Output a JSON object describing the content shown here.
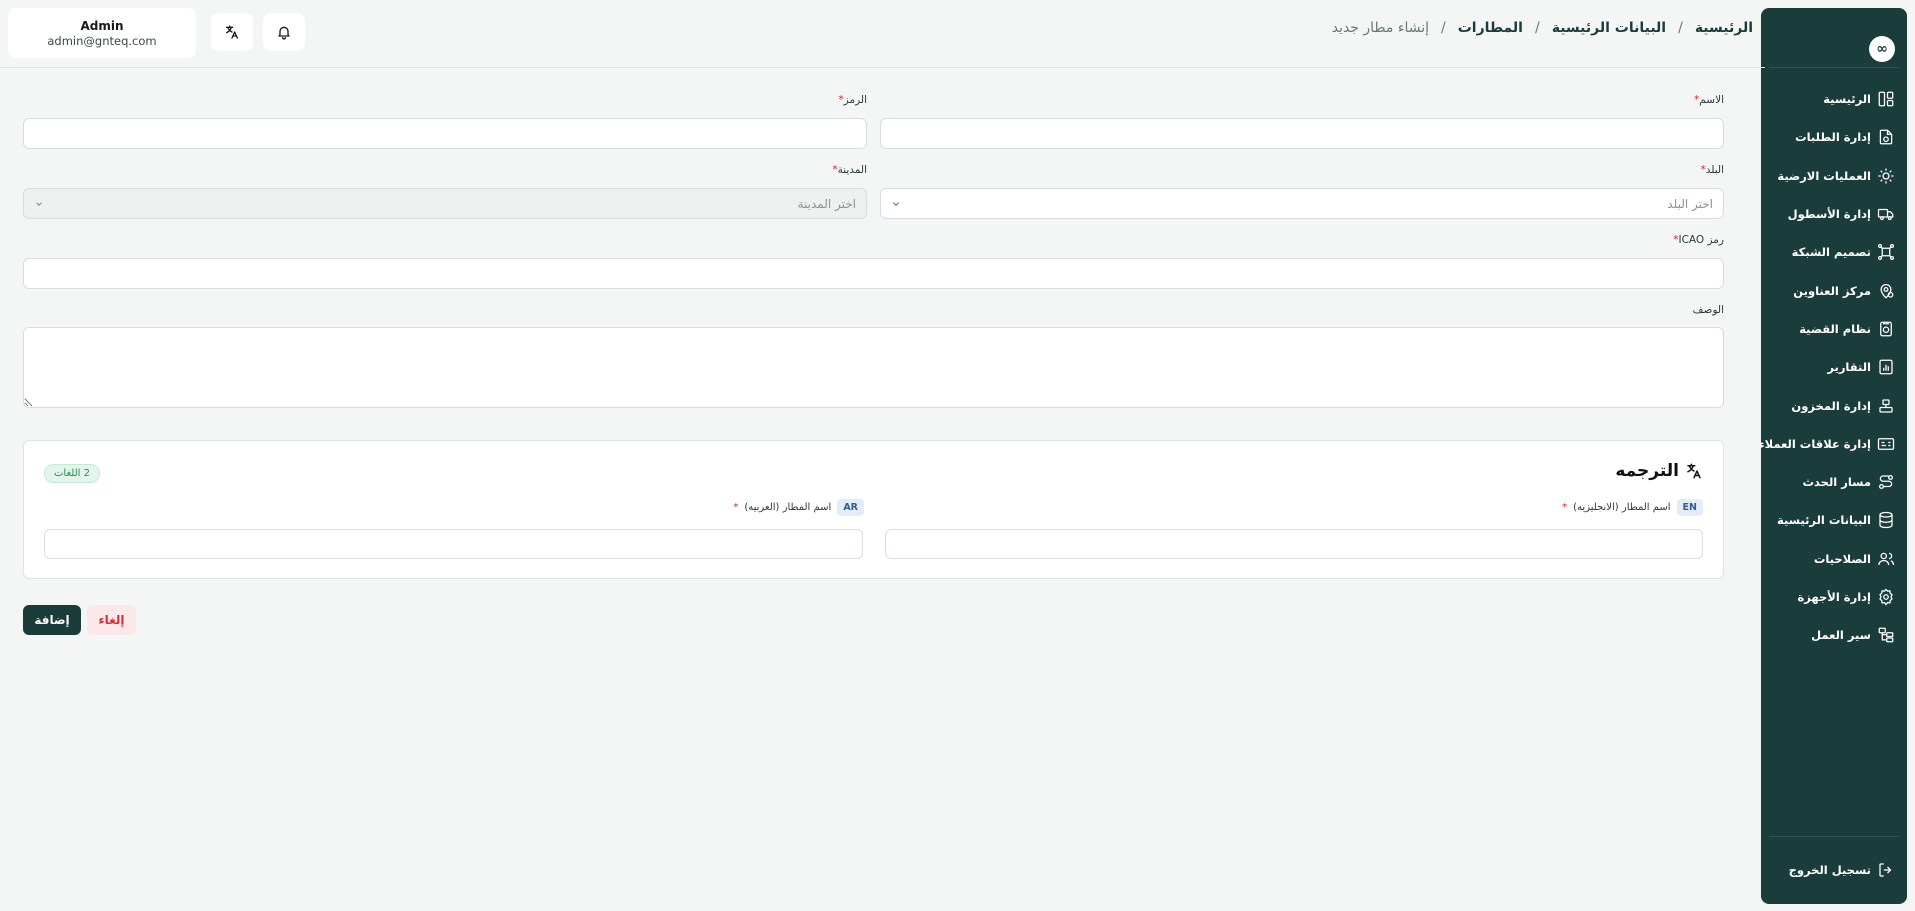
{
  "user": {
    "name": "Admin",
    "email": "admin@gnteq.com"
  },
  "header": {
    "translate_icon": "translate-icon",
    "bell_icon": "bell-icon"
  },
  "breadcrumb": {
    "items": [
      "الرئيسية",
      "البيانات الرئيسية",
      "المطارات"
    ],
    "current": "إنشاء مطار جديد",
    "separator": "/"
  },
  "sidebar": {
    "logo": "∞",
    "items": [
      {
        "label": "الرئيسية",
        "icon": "layout-dashboard-icon"
      },
      {
        "label": "إدارة الطلبات",
        "icon": "order-file-icon"
      },
      {
        "label": "العمليات الارضية",
        "icon": "ground-ops-gear-icon"
      },
      {
        "label": "إدارة الأسطول",
        "icon": "truck-icon"
      },
      {
        "label": "تصميم الشبكة",
        "icon": "network-icon"
      },
      {
        "label": "مركز العناوين",
        "icon": "map-pin-icon"
      },
      {
        "label": "نظام القضية",
        "icon": "case-file-icon"
      },
      {
        "label": "التقارير",
        "icon": "report-chart-icon"
      },
      {
        "label": "إدارة المخزون",
        "icon": "inventory-icon"
      },
      {
        "label": "إدارة علاقات العملاء",
        "icon": "crm-card-icon"
      },
      {
        "label": "مسار الحدث",
        "icon": "route-icon"
      },
      {
        "label": "البيانات الرئيسية",
        "icon": "database-icon"
      },
      {
        "label": "الصلاحيات",
        "icon": "users-icon"
      },
      {
        "label": "إدارة الأجهزة",
        "icon": "device-settings-icon"
      },
      {
        "label": "سير العمل",
        "icon": "workflow-icon"
      }
    ],
    "logout_label": "تسجيل الخروج"
  },
  "form": {
    "name": {
      "label": "الاسم",
      "value": ""
    },
    "code": {
      "label": "الرمز",
      "value": ""
    },
    "country": {
      "label": "البلد",
      "placeholder": "اختر البلد"
    },
    "city": {
      "label": "المدينة",
      "placeholder": "اختر المدينة",
      "disabled": true
    },
    "icao": {
      "label": "رمز ICAO",
      "value": ""
    },
    "description": {
      "label": "الوصف",
      "value": ""
    },
    "required_mark": "*"
  },
  "translation": {
    "title": "الترجمه",
    "languages_badge": "2 اللغات",
    "en": {
      "code": "EN",
      "label": "اسم المطار (الانجليزيه)",
      "value": ""
    },
    "ar": {
      "code": "AR",
      "label": "اسم المطار (العربيه)",
      "value": ""
    }
  },
  "actions": {
    "add": "إضافة",
    "cancel": "إلغاء"
  },
  "colors": {
    "primary": "#1a3c3b",
    "background": "#f4f6f5",
    "danger": "#d0303a",
    "success_badge": "#2a8b51"
  }
}
